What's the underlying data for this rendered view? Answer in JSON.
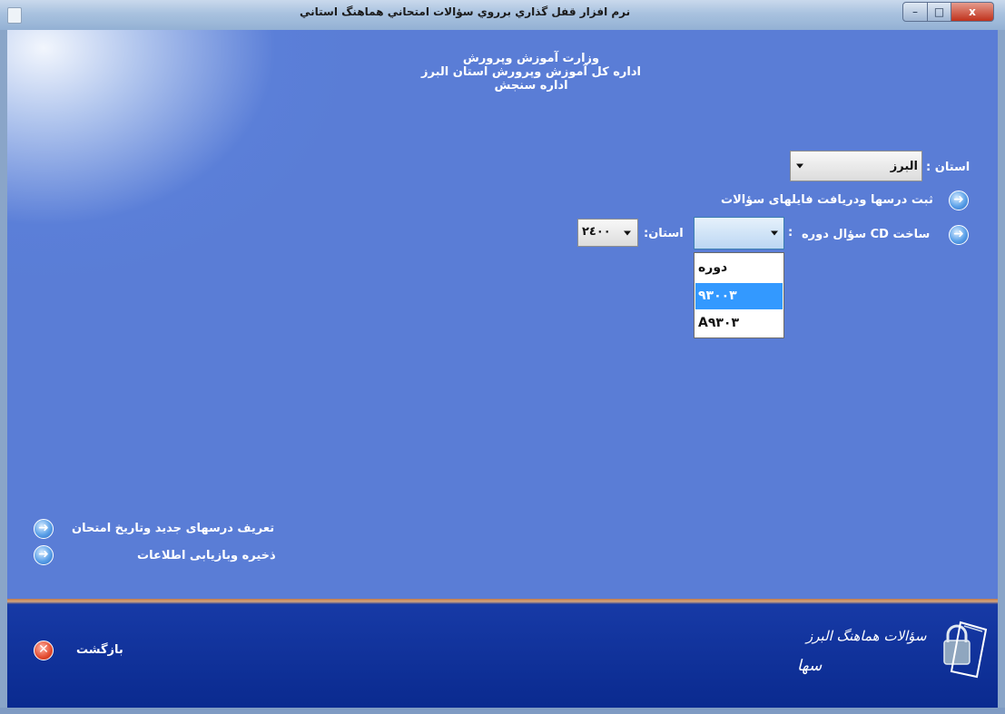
{
  "window": {
    "title": "نرم افزار قفل گذاري برروي سؤالات امتحاني هماهنگ استاني",
    "controls": {
      "minimize": "–",
      "maximize": "□",
      "close": "x"
    }
  },
  "header": {
    "line1": "وزارت آموزش وپرورش",
    "line2": "اداره کل آموزش وپرورش استان البرز",
    "line3": "اداره سنجش"
  },
  "province": {
    "label": "استان :",
    "selected": "البرز"
  },
  "actions": {
    "register_courses": "ثبت درسها ودریافت فایلهای سؤالات",
    "make_cd": "ساخت CD سؤال دوره",
    "colon": ":",
    "province_short_label": "استان:",
    "province_code": "۲٤۰۰"
  },
  "term_dropdown": {
    "current_value": "",
    "options": [
      "دوره",
      "۹۳۰۰۳",
      "A۹۳۰۳"
    ],
    "highlighted_index": 1
  },
  "left_actions": {
    "define_courses": "تعریف درسهای جدید وتاریخ امتحان",
    "backup": "ذخیره وبازیابی اطلاعات"
  },
  "footer": {
    "back_label": "بازگشت",
    "logo_text_line1": "سؤالات هماهنگ البرز",
    "logo_text_line2": "سها"
  },
  "colors": {
    "client_bg": "#5a7dd6",
    "footer_bg": "#0a2a8f",
    "highlight": "#3399ff"
  }
}
